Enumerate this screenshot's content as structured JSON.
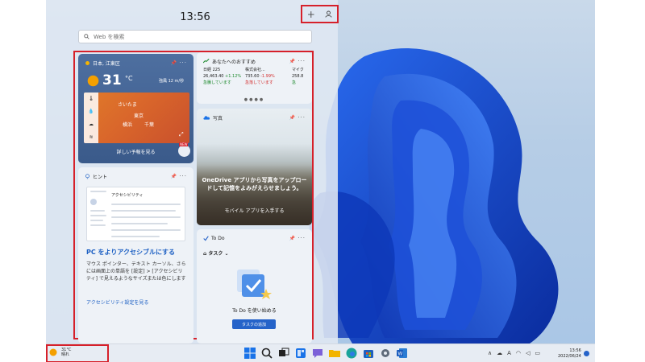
{
  "panel": {
    "clock": "13:56",
    "add_button": "+",
    "profile_button": "👤",
    "search_placeholder": "Web を検索"
  },
  "weather": {
    "location": "日本, 江東区",
    "temperature": "31",
    "unit": "°C",
    "wind": "強風 12 m/秒",
    "map_labels": [
      "さいたま",
      "東京",
      "横浜",
      "千葉"
    ],
    "forecast_link": "詳しい予報を見る",
    "new_badge": "NEW"
  },
  "finance": {
    "title": "あなたへのおすすめ",
    "stocks": [
      {
        "name": "日経 225",
        "value": "26,463.40",
        "change": "+1.12%",
        "status": "急騰しています",
        "trend": "up"
      },
      {
        "name": "株式会社...",
        "value": "735.60",
        "change": "-1.99%",
        "status": "急落しています",
        "trend": "down"
      },
      {
        "name": "マイク",
        "value": "258.8",
        "change": "",
        "status": "急",
        "trend": "up"
      }
    ]
  },
  "photos": {
    "title": "写真",
    "caption": "OneDrive アプリから写真をアップロードして記憶をよみがえらせましょう。",
    "link": "モバイル アプリを入手する"
  },
  "tips": {
    "title": "ヒント",
    "screenshot_title": "アクセシビリティ",
    "headline": "PC をよりアクセシブルにする",
    "body": "マウス ポインター、テキスト カーソル、さらには画面上の単語を [設定] > [アクセシビリティ] で見えるようなサイズまたは色にします",
    "link": "アクセシビリティ設定を見る"
  },
  "todo": {
    "title": "To Do",
    "task_list": "タスク",
    "message": "To Do を使い始める",
    "add_button": "タスクの追加"
  },
  "taskbar": {
    "weather_temp": "31°C",
    "weather_cond": "晴れ",
    "time": "13:56",
    "date": "2022/06/24",
    "tray_ime": "A"
  },
  "colors": {
    "highlight": "#d6202a",
    "accent": "#2563c9",
    "up": "#1e8a2e",
    "down": "#d32f2f"
  }
}
